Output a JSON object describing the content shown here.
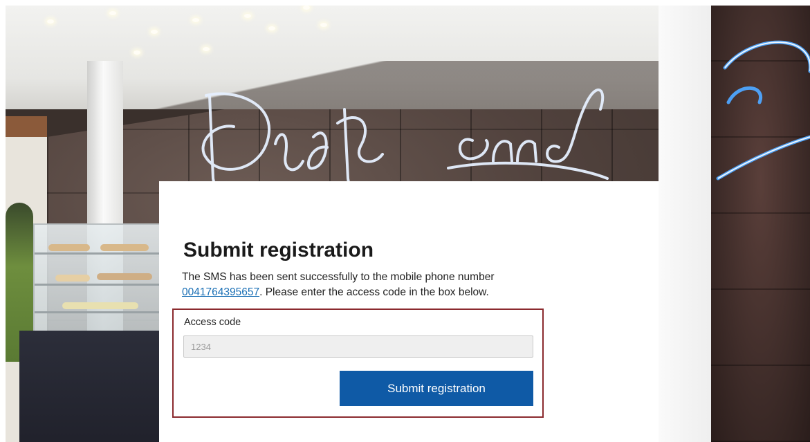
{
  "form": {
    "title": "Submit registration",
    "message_before": "The SMS has been sent successfully to the mobile phone number",
    "phone_number": "0041764395657",
    "message_after": ". Please enter the access code in the box below.",
    "access_code_label": "Access code",
    "access_code_placeholder": "1234",
    "access_code_value": "",
    "submit_label": "Submit registration"
  },
  "colors": {
    "button": "#0f5aa6",
    "link": "#1a6fb5",
    "highlight_border": "#8b2a2e"
  }
}
